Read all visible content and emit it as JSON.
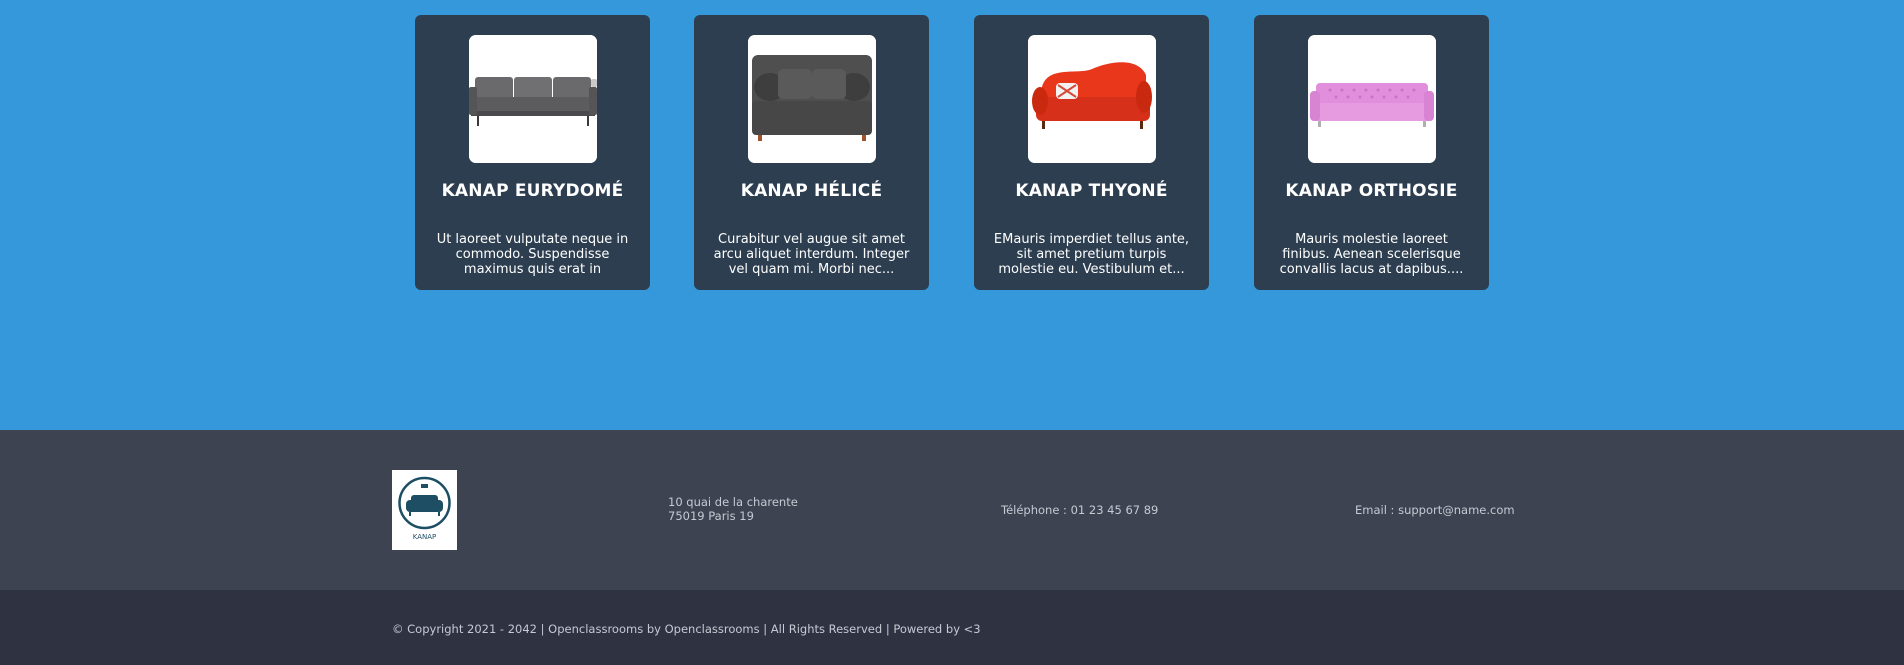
{
  "products": [
    {
      "name": "Kanap Eurydomé",
      "description": "Ut laoreet vulputate neque in commodo. Suspendisse maximus quis erat in sagittis....",
      "image": "gray-sofa"
    },
    {
      "name": "Kanap Hélicé",
      "description": "Curabitur vel augue sit amet arcu aliquet interdum. Integer vel quam mi. Morbi nec...",
      "image": "dark-gray-loveseat"
    },
    {
      "name": "Kanap Thyoné",
      "description": "EMauris imperdiet tellus ante, sit amet pretium turpis molestie eu. Vestibulum et...",
      "image": "red-sofa"
    },
    {
      "name": "Kanap orthosie",
      "description": "Mauris molestie laoreet finibus. Aenean scelerisque convallis lacus at dapibus....",
      "image": "pink-sofa"
    }
  ],
  "footer": {
    "logo_text": "KANAP",
    "address_line1": "10 quai de la charente",
    "address_line2": "75019 Paris 19",
    "phone": "Téléphone : 01 23 45 67 89",
    "email": "Email : support@name.com",
    "copyright": "© Copyright 2021 - 2042 | Openclassrooms by Openclassrooms | All Rights Reserved | Powered by <3"
  },
  "colors": {
    "page_background": "#3498db",
    "card_background": "#2c3e50",
    "footer_background": "#3d4350",
    "bottom_bar_background": "#2f3241",
    "logo_color": "#1d4e63"
  }
}
